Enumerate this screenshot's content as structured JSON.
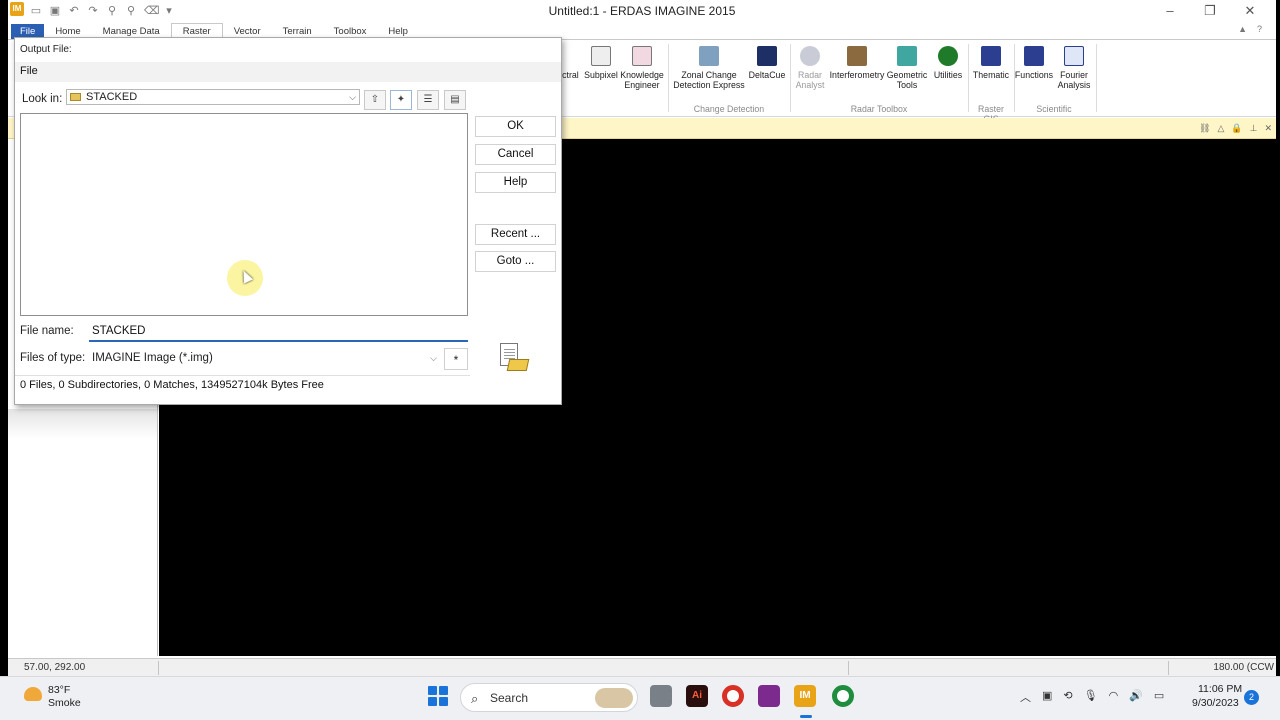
{
  "app": {
    "title": "Untitled:1 - ERDAS IMAGINE 2015",
    "logo_text": "IM",
    "ribbon_tabs": [
      "File",
      "Home",
      "Manage Data",
      "Raster",
      "Vector",
      "Terrain",
      "Toolbox",
      "Help"
    ],
    "active_tab": "Raster",
    "ribbon_buttons": [
      {
        "label": "ectral",
        "icon": "spectral-icon"
      },
      {
        "label": "Subpixel",
        "icon": "subpixel-icon"
      },
      {
        "label": "Knowledge Engineer",
        "icon": "knowledge-engineer-icon"
      },
      {
        "label": "Zonal Change Detection Express",
        "icon": "zonal-change-icon"
      },
      {
        "label": "DeltaCue",
        "icon": "deltacue-icon"
      },
      {
        "label": "Radar Analyst",
        "icon": "radar-analyst-icon"
      },
      {
        "label": "Interferometry",
        "icon": "interferometry-icon"
      },
      {
        "label": "Geometric Tools",
        "icon": "geometric-tools-icon"
      },
      {
        "label": "Utilities",
        "icon": "utilities-icon"
      },
      {
        "label": "Thematic",
        "icon": "thematic-icon"
      },
      {
        "label": "Functions",
        "icon": "functions-icon"
      },
      {
        "label": "Fourier Analysis",
        "icon": "fourier-icon"
      }
    ],
    "ribbon_groups": [
      "Change Detection",
      "Radar Toolbox",
      "Raster GIS",
      "Scientific"
    ],
    "status": {
      "coords": "57.00, 292.00",
      "rotation": "180.00 (CCW"
    }
  },
  "dialog": {
    "title": "Output File:",
    "menu_file": "File",
    "look_in_label": "Look in:",
    "look_in_value": "STACKED",
    "buttons": {
      "ok": "OK",
      "cancel": "Cancel",
      "help": "Help",
      "recent": "Recent ...",
      "goto": "Goto ..."
    },
    "file_name_label": "File name:",
    "file_name_value": "STACKED",
    "file_type_label": "Files of type:",
    "file_type_value": "IMAGINE Image (*.img)",
    "filter_button": "*",
    "status": "0 Files, 0 Subdirectories, 0 Matches, 1349527104k Bytes Free"
  },
  "taskbar": {
    "temperature": "83°F",
    "weather": "Smoke",
    "search_label": "Search",
    "time": "11:06 PM",
    "date": "9/30/2023",
    "notifications": "2",
    "ai_app_label": "Ai"
  },
  "colors": {
    "accent": "#2b5fb3",
    "infobar": "#fff6c7",
    "taskbar_accent": "#1a73d9"
  }
}
